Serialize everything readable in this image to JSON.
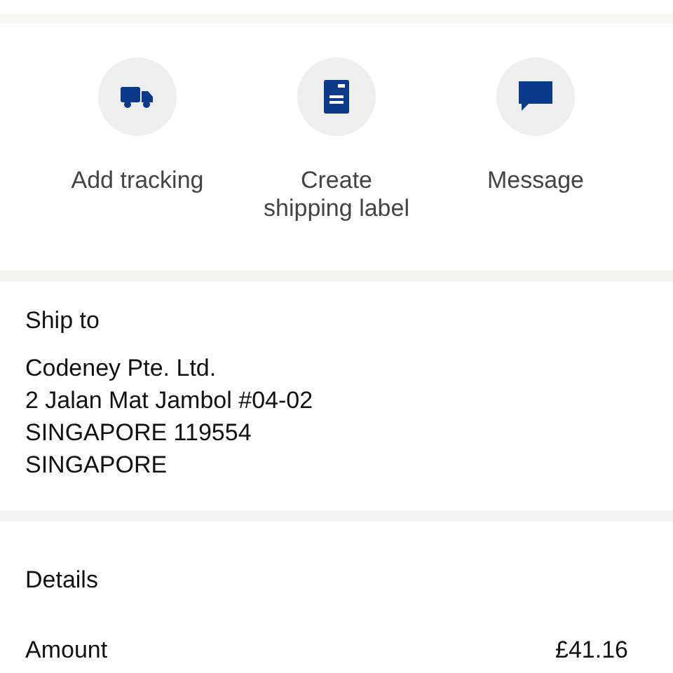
{
  "actions": [
    {
      "kind": "truck",
      "label": "Add tracking"
    },
    {
      "kind": "label",
      "label": "Create shipping label"
    },
    {
      "kind": "message",
      "label": "Message"
    }
  ],
  "ship_to": {
    "title": "Ship to",
    "address_lines": [
      "Codeney Pte. Ltd.",
      "2 Jalan Mat Jambol #04-02",
      "SINGAPORE 119554",
      "SINGAPORE"
    ]
  },
  "details": {
    "title": "Details",
    "rows": [
      {
        "label": "Amount",
        "value": "£41.16"
      }
    ]
  }
}
